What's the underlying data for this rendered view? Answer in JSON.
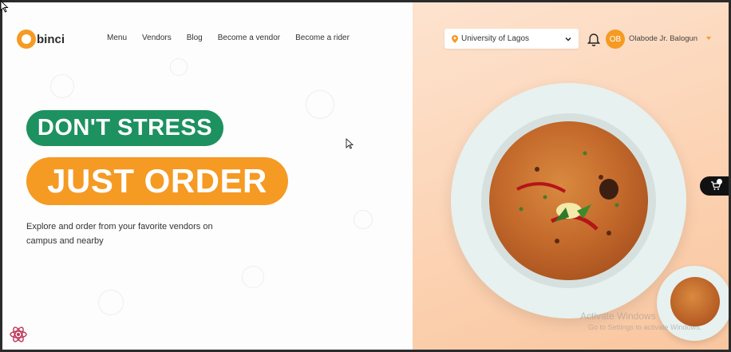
{
  "header": {
    "logo_text": "binci",
    "nav": [
      "Menu",
      "Vendors",
      "Blog",
      "Become a vendor",
      "Become a rider"
    ],
    "location": {
      "value": "University of Lagos"
    },
    "user": {
      "initials": "OB",
      "name": "Olabode Jr. Balogun"
    }
  },
  "hero": {
    "headline_1": "DON'T STRESS",
    "headline_2": "JUST ORDER",
    "description": "Explore and order from your favorite vendors on campus and nearby"
  },
  "colors": {
    "brand_orange": "#f59a23",
    "brand_green": "#1d9160"
  },
  "icons": [
    "location-pin-icon",
    "chevron-down-icon",
    "bell-icon",
    "cart-icon",
    "react-icon",
    "cursor-icon"
  ],
  "overlay": {
    "watermark_1": "Activate Windows",
    "watermark_2": "Go to Settings to activate Windows."
  }
}
